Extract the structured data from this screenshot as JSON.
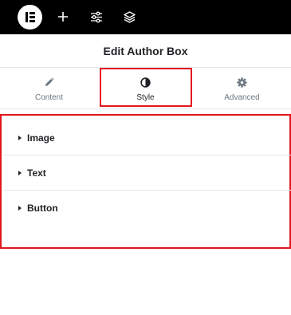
{
  "topbar": {
    "logo_icon": "elementor-logo-icon",
    "icons": [
      "plus-icon",
      "sliders-icon",
      "layers-icon"
    ]
  },
  "panel": {
    "title": "Edit Author Box"
  },
  "tabs": [
    {
      "label": "Content",
      "icon": "pencil-icon",
      "active": false
    },
    {
      "label": "Style",
      "icon": "half-circle-icon",
      "active": true
    },
    {
      "label": "Advanced",
      "icon": "gear-icon",
      "active": false
    }
  ],
  "sections": [
    {
      "label": "Image"
    },
    {
      "label": "Text"
    },
    {
      "label": "Button"
    }
  ],
  "colors": {
    "topbar": "#000000",
    "highlight": "#e2171c",
    "text_dark": "#1f2124",
    "text_muted": "#6d7882",
    "divider": "#e6e8ea"
  }
}
